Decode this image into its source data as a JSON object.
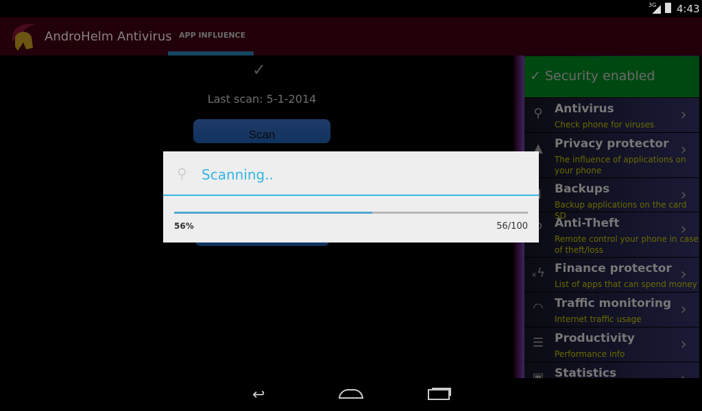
{
  "status_bar": {
    "network": "3G",
    "time": "4:43"
  },
  "action_bar": {
    "app_title": "AndroHelm Antivirus",
    "tabs": [
      {
        "label": "APP INFLUENCE",
        "selected": true
      }
    ]
  },
  "main": {
    "last_scan": "Last scan: 5-1-2014",
    "scan_label": "Scan"
  },
  "panel": {
    "header": "Security enabled",
    "header_color": "#004812",
    "items": [
      {
        "icon": "search-icon",
        "title": "Antivirus",
        "subtitle": "Check phone for viruses"
      },
      {
        "icon": "warning-icon",
        "title": "Privacy protector",
        "subtitle": "The influence of applications on your phone"
      },
      {
        "icon": "sd-card-icon",
        "title": "Backups",
        "subtitle": "Backup applications on the card SD"
      },
      {
        "icon": "search-icon",
        "title": "Anti-Theft",
        "subtitle": "Remote control your phone in case of theft/loss"
      },
      {
        "icon": "finance-icon",
        "title": "Finance protector",
        "subtitle": "List of apps that can spend money"
      },
      {
        "icon": "wifi-icon",
        "title": "Traffic monitoring",
        "subtitle": "Internet traffic usage"
      },
      {
        "icon": "document-icon",
        "title": "Productivity",
        "subtitle": "Performance info"
      },
      {
        "icon": "clipboard-icon",
        "title": "Statistics",
        "subtitle": ""
      }
    ]
  },
  "dialog": {
    "title": "Scanning..",
    "percent_label": "56%",
    "count_label": "56/100",
    "progress": 0.56,
    "accent": "#33b5e5"
  }
}
